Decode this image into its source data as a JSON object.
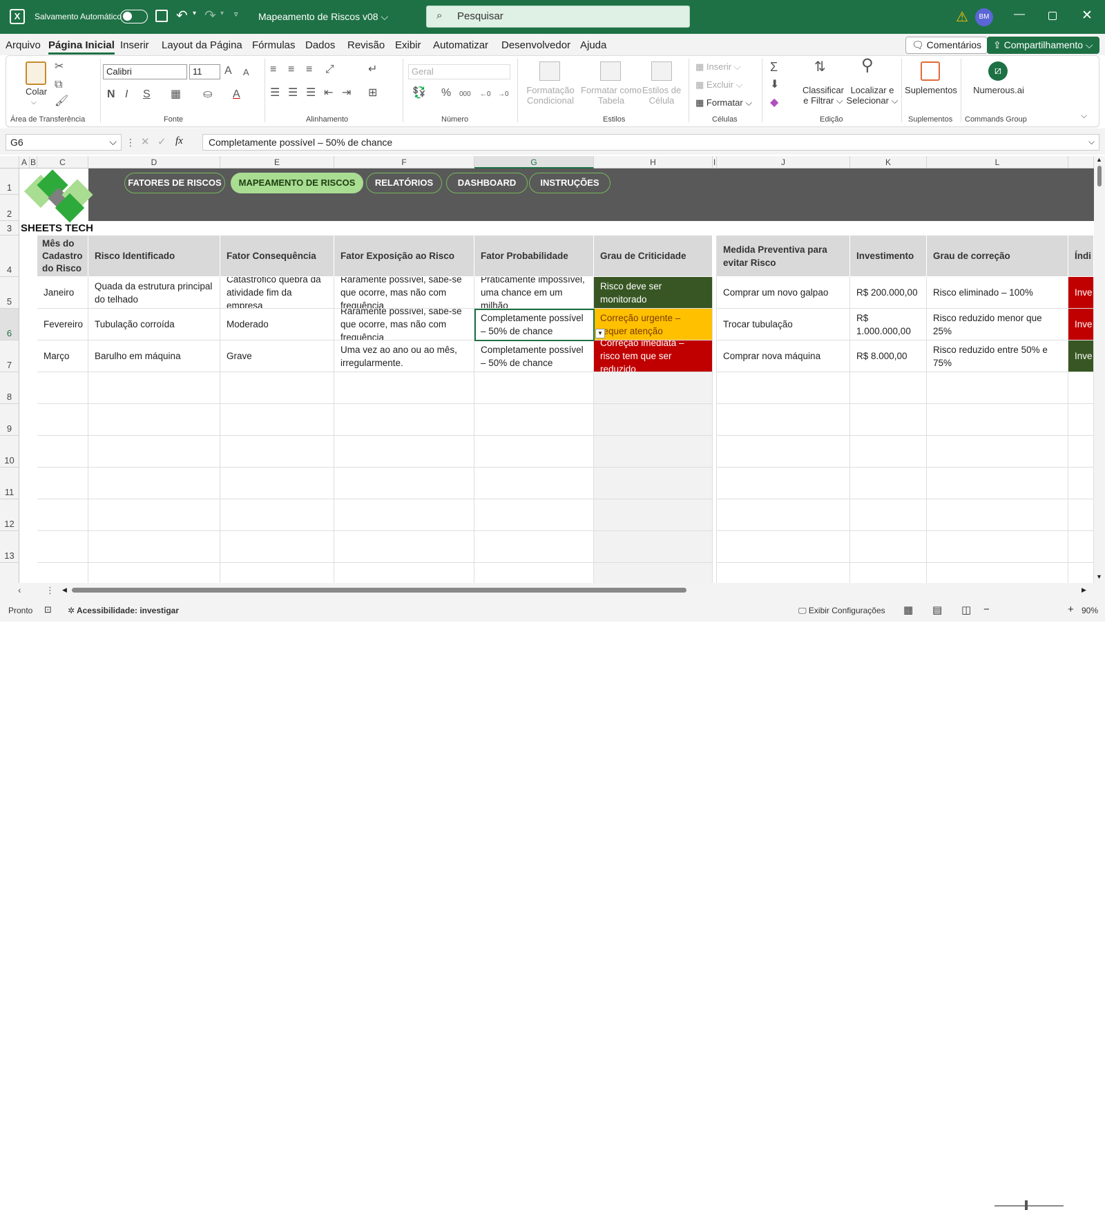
{
  "titlebar": {
    "autosave_label": "Salvamento Automático",
    "doc_title": "Mapeamento de Riscos v08",
    "search_placeholder": "Pesquisar",
    "user_initials": "BM"
  },
  "menu": {
    "items": [
      "Arquivo",
      "Página Inicial",
      "Inserir",
      "Layout da Página",
      "Fórmulas",
      "Dados",
      "Revisão",
      "Exibir",
      "Automatizar",
      "Desenvolvedor",
      "Ajuda"
    ],
    "comments": "Comentários",
    "share": "Compartilhamento"
  },
  "ribbon": {
    "paste": "Colar",
    "font_name": "Calibri",
    "font_size": "11",
    "number_format": "Geral",
    "cond_format": [
      "Formatação",
      "Condicional"
    ],
    "format_table": [
      "Formatar como",
      "Tabela"
    ],
    "cell_styles": [
      "Estilos de",
      "Célula"
    ],
    "insert": "Inserir",
    "delete": "Excluir",
    "format": "Formatar",
    "sort_filter": [
      "Classificar",
      "e Filtrar"
    ],
    "find_select": [
      "Localizar e",
      "Selecionar"
    ],
    "addins": "Suplementos",
    "numerous": "Numerous.ai",
    "groups": {
      "clipboard": "Área de Transferência",
      "font": "Fonte",
      "alignment": "Alinhamento",
      "number": "Número",
      "styles": "Estilos",
      "cells": "Células",
      "editing": "Edição",
      "addins": "Suplementos",
      "commands": "Commands Group"
    }
  },
  "formula_bar": {
    "cell_ref": "G6",
    "fx": "fx",
    "content": "Completamente possível – 50% de chance"
  },
  "columns": [
    "A",
    "B",
    "C",
    "D",
    "E",
    "F",
    "G",
    "H",
    "I",
    "J",
    "K",
    "L"
  ],
  "rows": [
    "1",
    "2",
    "3",
    "4",
    "5",
    "6",
    "7",
    "8",
    "9",
    "10",
    "11",
    "12",
    "13"
  ],
  "banner": {
    "brand": "SHEETS TECH",
    "nav": [
      "FATORES DE RISCOS",
      "MAPEAMENTO DE RISCOS",
      "RELATÓRIOS",
      "DASHBOARD",
      "INSTRUÇÕES"
    ]
  },
  "table": {
    "headers": [
      "Mês do Cadastro do Risco",
      "Risco Identificado",
      "Fator Consequência",
      "Fator Exposição ao Risco",
      "Fator Probabilidade",
      "Grau de Criticidade",
      "Medida Preventiva para evitar Risco",
      "Investimento",
      "Grau de correção",
      "Índi"
    ],
    "rows": [
      [
        "Janeiro",
        "Quada da estrutura principal do telhado",
        "Catastrófico quebra da atividade fim da empresa",
        "Raramente possível, sabe-se que ocorre, mas não com frequência",
        "Praticamente impossível, uma chance em um milhão",
        "Risco deve ser monitorado",
        "Comprar um novo galpao",
        "R$ 200.000,00",
        "Risco eliminado – 100%",
        "Inve"
      ],
      [
        "Fevereiro",
        "Tubulação corroída",
        "Moderado",
        "Raramente possível, sabe-se que ocorre, mas não com frequência",
        "Completamente possível – 50% de chance",
        "Correção urgente – requer atenção",
        "Trocar tubulação",
        "R$ 1.000.000,00",
        "Risco reduzido menor que 25%",
        "Inve"
      ],
      [
        "Março",
        "Barulho em máquina",
        "Grave",
        "Uma vez ao ano ou ao mês, irregularmente.",
        "Completamente possível – 50% de chance",
        "Correção imediata – risco tem que ser reduzido",
        "Comprar nova máquina",
        "R$ 8.000,00",
        "Risco reduzido entre 50% e 75%",
        "Inve"
      ]
    ],
    "criticality_colors": [
      "#375623",
      "#ffc000",
      "#c00000"
    ],
    "criticality_text_colors": [
      "#ffffff",
      "#7a3b00",
      "#ffffff"
    ],
    "index_colors": [
      "#c00000",
      "#c00000",
      "#375623"
    ]
  },
  "status": {
    "ready": "Pronto",
    "accessibility": "Acessibilidade: investigar",
    "display_settings": "Exibir Configurações",
    "zoom": "90%"
  },
  "colors": {
    "brand": "#1e7145",
    "banner": "#595959"
  }
}
